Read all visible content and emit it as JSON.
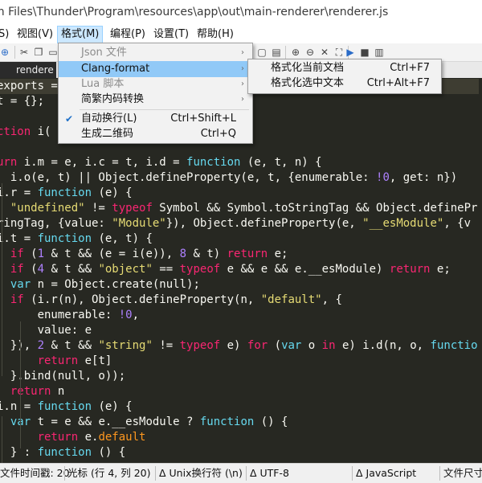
{
  "window": {
    "title": "m Files\\Thunder\\Program\\resources\\app\\out\\main-renderer\\renderer.js"
  },
  "menubar": [
    "S)",
    "视图(V)",
    "格式(M)",
    "编程(P)",
    "设置(T)",
    "帮助(H)"
  ],
  "tab": {
    "label": "rendere"
  },
  "format_menu": {
    "items": [
      {
        "label": "Json 文件",
        "shortcut": "",
        "disabled": true,
        "submenu": true
      },
      {
        "label": "Clang-format",
        "shortcut": "",
        "disabled": false,
        "submenu": true,
        "highlighted": true
      },
      {
        "label": "Lua 脚本",
        "shortcut": "",
        "disabled": true,
        "submenu": true
      },
      {
        "label": "简繁内码转换",
        "shortcut": "",
        "disabled": false,
        "submenu": true
      },
      {
        "label": "自动换行(L)",
        "shortcut": "Ctrl+Shift+L",
        "checked": true
      },
      {
        "label": "生成二维码",
        "shortcut": "Ctrl+Q"
      }
    ]
  },
  "clang_submenu": {
    "items": [
      {
        "label": "格式化当前文档",
        "shortcut": "Ctrl+F7"
      },
      {
        "label": "格式化选中文本",
        "shortcut": "Ctrl+Alt+F7"
      }
    ]
  },
  "statusbar": {
    "modified": "文件时间戳: 20",
    "cursor": "光标 (行 4, 列 20)",
    "eol": "Δ Unix换行符 (\\n)",
    "encoding": "Δ UTF-8",
    "language": "Δ JavaScript",
    "filesize": "文件尺寸"
  },
  "icons": [
    "new-icon",
    "cut-icon",
    "copy-icon",
    "paste-icon",
    "undo-icon",
    "redo-icon",
    "find-icon",
    "replace-icon",
    "copy-doc-icon",
    "save-icon",
    "zoom-in-icon",
    "zoom-out-icon",
    "close-icon",
    "fullscreen-icon",
    "run-icon",
    "record-icon",
    "clipboard-icon"
  ],
  "code": [
    {
      "segs": [
        [
          "p",
          "exports = "
        ]
      ]
    },
    {
      "segs": [
        [
          "p",
          "t = {};"
        ]
      ]
    },
    {
      "segs": [
        [
          "p",
          ""
        ]
      ]
    },
    {
      "segs": [
        [
          "k",
          "ction"
        ],
        [
          "p",
          " i("
        ]
      ]
    },
    {
      "segs": [
        [
          "p",
          ""
        ]
      ]
    },
    {
      "segs": [
        [
          "k",
          "urn"
        ],
        [
          "p",
          " i.m = e, i.c = t, i.d = "
        ],
        [
          "f",
          "function"
        ],
        [
          "p",
          " (e, t, n) {"
        ]
      ]
    },
    {
      "segs": [
        [
          "p",
          "  i.o(e, t) || Object.defineProperty(e, t, {enumerable: "
        ],
        [
          "n",
          "!0"
        ],
        [
          "p",
          ", get: n})"
        ]
      ]
    },
    {
      "segs": [
        [
          "p",
          "i.r = "
        ],
        [
          "f",
          "function"
        ],
        [
          "p",
          " (e) {"
        ]
      ]
    },
    {
      "segs": [
        [
          "p",
          "  "
        ],
        [
          "s",
          "\"undefined\""
        ],
        [
          "p",
          " != "
        ],
        [
          "k",
          "typeof"
        ],
        [
          "p",
          " Symbol && Symbol.toStringTag && Object.definePr"
        ]
      ]
    },
    {
      "segs": [
        [
          "p",
          "ringTag, {value: "
        ],
        [
          "s",
          "\"Module\""
        ],
        [
          "p",
          "}), Object.defineProperty(e, "
        ],
        [
          "s",
          "\"__esModule\""
        ],
        [
          "p",
          ", {v"
        ]
      ]
    },
    {
      "segs": [
        [
          "p",
          "i.t = "
        ],
        [
          "f",
          "function"
        ],
        [
          "p",
          " (e, t) {"
        ]
      ]
    },
    {
      "segs": [
        [
          "p",
          "  "
        ],
        [
          "k",
          "if"
        ],
        [
          "p",
          " ("
        ],
        [
          "n",
          "1"
        ],
        [
          "p",
          " & t && (e = i(e)), "
        ],
        [
          "n",
          "8"
        ],
        [
          "p",
          " & t) "
        ],
        [
          "k",
          "return"
        ],
        [
          "p",
          " e;"
        ]
      ]
    },
    {
      "segs": [
        [
          "p",
          "  "
        ],
        [
          "k",
          "if"
        ],
        [
          "p",
          " ("
        ],
        [
          "n",
          "4"
        ],
        [
          "p",
          " & t && "
        ],
        [
          "s",
          "\"object\""
        ],
        [
          "p",
          " == "
        ],
        [
          "k",
          "typeof"
        ],
        [
          "p",
          " e && e && e.__esModule) "
        ],
        [
          "k",
          "return"
        ],
        [
          "p",
          " e;"
        ]
      ]
    },
    {
      "segs": [
        [
          "p",
          "  "
        ],
        [
          "f",
          "var"
        ],
        [
          "p",
          " n = Object.create(null);"
        ]
      ]
    },
    {
      "segs": [
        [
          "p",
          "  "
        ],
        [
          "k",
          "if"
        ],
        [
          "p",
          " (i.r(n), Object.defineProperty(n, "
        ],
        [
          "s",
          "\"default\""
        ],
        [
          "p",
          ", {"
        ]
      ]
    },
    {
      "segs": [
        [
          "p",
          "      enumerable: "
        ],
        [
          "n",
          "!0"
        ],
        [
          "p",
          ","
        ]
      ]
    },
    {
      "segs": [
        [
          "p",
          "      value: e"
        ]
      ]
    },
    {
      "segs": [
        [
          "p",
          "  }), "
        ],
        [
          "n",
          "2"
        ],
        [
          "p",
          " & t && "
        ],
        [
          "s",
          "\"string\""
        ],
        [
          "p",
          " != "
        ],
        [
          "k",
          "typeof"
        ],
        [
          "p",
          " e) "
        ],
        [
          "k",
          "for"
        ],
        [
          "p",
          " ("
        ],
        [
          "f",
          "var"
        ],
        [
          "p",
          " o "
        ],
        [
          "k",
          "in"
        ],
        [
          "p",
          " e) i.d(n, o, "
        ],
        [
          "f",
          "functio"
        ]
      ]
    },
    {
      "segs": [
        [
          "p",
          "      "
        ],
        [
          "k",
          "return"
        ],
        [
          "p",
          " e[t]"
        ]
      ]
    },
    {
      "segs": [
        [
          "p",
          "  }.bind(null, o));"
        ]
      ]
    },
    {
      "segs": [
        [
          "p",
          "  "
        ],
        [
          "k",
          "return"
        ],
        [
          "p",
          " n"
        ]
      ]
    },
    {
      "segs": [
        [
          "p",
          "i.n = "
        ],
        [
          "f",
          "function"
        ],
        [
          "p",
          " (e) {"
        ]
      ]
    },
    {
      "segs": [
        [
          "p",
          "  "
        ],
        [
          "f",
          "var"
        ],
        [
          "p",
          " t = e && e.__esModule ? "
        ],
        [
          "f",
          "function"
        ],
        [
          "p",
          " () {"
        ]
      ]
    },
    {
      "segs": [
        [
          "p",
          "      "
        ],
        [
          "k",
          "return"
        ],
        [
          "p",
          " e."
        ],
        [
          "o",
          "default"
        ]
      ]
    },
    {
      "segs": [
        [
          "p",
          "  } : "
        ],
        [
          "f",
          "function"
        ],
        [
          "p",
          " () {"
        ]
      ]
    }
  ],
  "colors": {
    "editor_bg": "#272822",
    "keyword": "#f92672",
    "function": "#66d9ef",
    "string": "#e6db74",
    "number": "#ae81ff",
    "menu_highlight": "#91c9f7"
  }
}
